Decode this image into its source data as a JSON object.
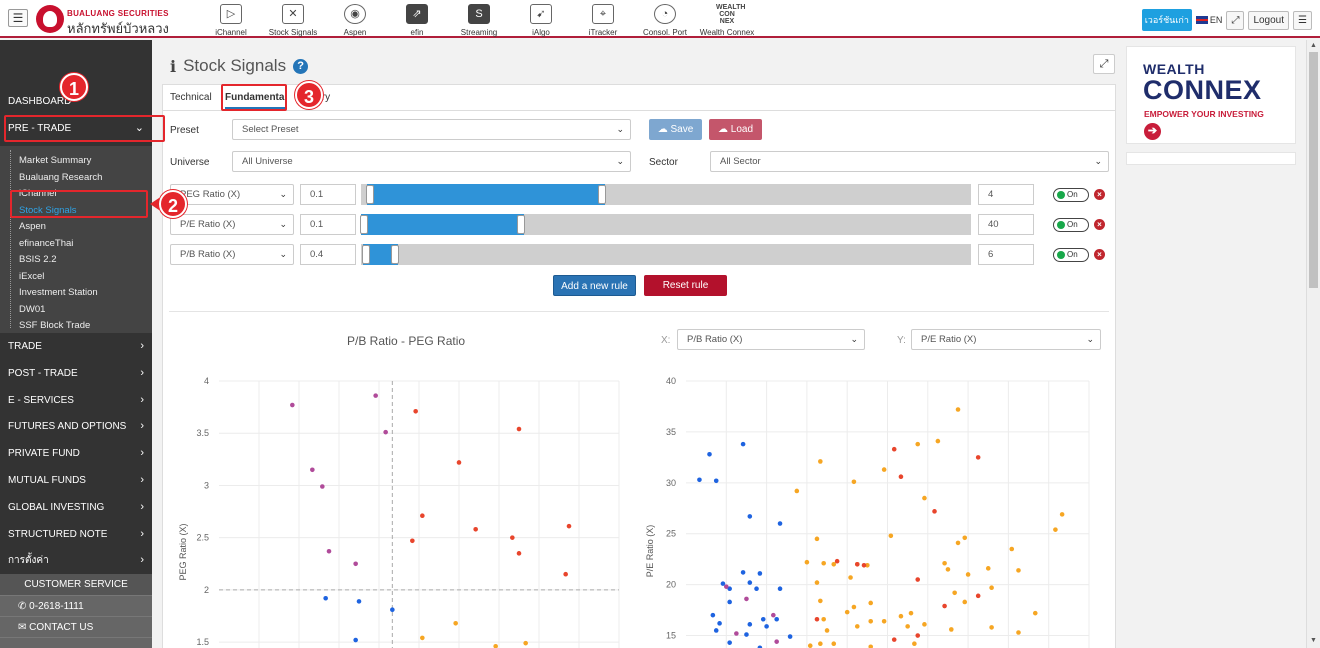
{
  "header": {
    "brand_en": "BUALUANG SECURITIES",
    "brand_th": "หลักทรัพย์บัวหลวง",
    "apps": [
      {
        "label": "iChannel",
        "icon": "play-icon",
        "glyph": "▷"
      },
      {
        "label": "Stock Signals",
        "icon": "chart-icon",
        "glyph": "✕"
      },
      {
        "label": "Aspen",
        "icon": "globe-icon",
        "glyph": "◉"
      },
      {
        "label": "efin",
        "icon": "efin-icon",
        "glyph": "⇗"
      },
      {
        "label": "Streaming",
        "icon": "streaming-icon",
        "glyph": "S"
      },
      {
        "label": "iAlgo",
        "icon": "rocket-icon",
        "glyph": "➹"
      },
      {
        "label": "iTracker",
        "icon": "telescope-icon",
        "glyph": "⌖"
      },
      {
        "label": "Consol. Port",
        "icon": "pie-icon",
        "glyph": "◔"
      },
      {
        "label": "Wealth Connex",
        "icon": "wealth-connex-icon",
        "glyph": "WEALTH CON NEX"
      }
    ],
    "old_version": "เวอร์ชันเก่า",
    "lang": "EN",
    "logout": "Logout"
  },
  "sidebar": {
    "top_items": [
      "DASHBOARD",
      "PRE - TRADE"
    ],
    "sub_items": [
      "Market Summary",
      "Bualuang Research",
      "iChannel",
      "Stock Signals",
      "Aspen",
      "efinanceThai",
      "BSIS 2.2",
      "iExcel",
      "Investment Station",
      "DW01",
      "SSF Block Trade"
    ],
    "active_sub": "Stock Signals",
    "bottom_items": [
      "TRADE",
      "POST - TRADE",
      "E - SERVICES",
      "FUTURES AND OPTIONS",
      "PRIVATE FUND",
      "MUTUAL FUNDS",
      "GLOBAL INVESTING",
      "STRUCTURED NOTE",
      "การตั้งค่า"
    ],
    "customer_service": "CUSTOMER SERVICE",
    "phone": "0-2618-1111",
    "contact": "CONTACT US"
  },
  "page": {
    "title": "Stock Signals",
    "tabs": [
      "Technical",
      "Fundamental",
      "History"
    ],
    "active_tab": "Fundamental",
    "preset_label": "Preset",
    "preset_value": "Select Preset",
    "save": "Save",
    "load": "Load",
    "universe_label": "Universe",
    "universe_value": "All Universe",
    "sector_label": "Sector",
    "sector_value": "All Sector",
    "rules": [
      {
        "metric": "PEG Ratio (X)",
        "min": "0.1",
        "max": "4",
        "range": [
          0.1,
          4
        ],
        "slider_max": 10,
        "toggle": "On"
      },
      {
        "metric": "P/E Ratio (X)",
        "min": "0.1",
        "max": "40",
        "range": [
          0.1,
          40
        ],
        "slider_max": 150,
        "toggle": "On"
      },
      {
        "metric": "P/B Ratio (X)",
        "min": "0.4",
        "max": "6",
        "range": [
          0.4,
          6
        ],
        "slider_max": 100,
        "toggle": "On"
      }
    ],
    "add_rule": "Add a new rule",
    "reset_rule": "Reset rule",
    "x_label": "X:",
    "y_label": "Y:",
    "x_select": "P/B Ratio (X)",
    "y_select": "P/E Ratio (X)"
  },
  "callouts": [
    "1",
    "2",
    "3"
  ],
  "ad": {
    "line1": "WEALTH",
    "line2": "CONNEX",
    "line3": "EMPOWER YOUR INVESTING"
  },
  "colors": {
    "accent": "#2475b8",
    "brand": "#c8102e",
    "blue": "#1e63e0",
    "orange": "#f6a623",
    "red": "#e8452c",
    "purple": "#b04b9a"
  },
  "chart_data": [
    {
      "type": "scatter",
      "title": "P/B Ratio - PEG Ratio",
      "xlabel": "",
      "ylabel": "PEG Ratio (X)",
      "ylim": [
        1.3,
        4
      ],
      "yticks": [
        1.5,
        2,
        2.5,
        3,
        3.5,
        4
      ],
      "xlim": [
        0,
        6
      ],
      "crosshair": {
        "x": 2.6,
        "y": 2
      },
      "series": [
        {
          "color": "purple",
          "points": [
            [
              1.1,
              3.77
            ],
            [
              1.4,
              3.15
            ],
            [
              1.55,
              2.99
            ],
            [
              1.65,
              2.37
            ],
            [
              2.05,
              2.25
            ],
            [
              2.35,
              3.86
            ],
            [
              2.5,
              3.51
            ]
          ]
        },
        {
          "color": "red",
          "points": [
            [
              2.95,
              3.71
            ],
            [
              3.05,
              2.71
            ],
            [
              2.9,
              2.47
            ],
            [
              3.6,
              3.22
            ],
            [
              3.85,
              2.58
            ],
            [
              4.5,
              3.54
            ],
            [
              4.4,
              2.5
            ],
            [
              4.5,
              2.35
            ],
            [
              5.25,
              2.61
            ],
            [
              5.2,
              2.15
            ]
          ]
        },
        {
          "color": "blue",
          "points": [
            [
              1.6,
              1.92
            ],
            [
              2.1,
              1.89
            ],
            [
              2.05,
              1.52
            ],
            [
              1.9,
              1.22
            ],
            [
              2.0,
              1.24
            ],
            [
              2.6,
              1.81
            ],
            [
              2.65,
              1.39
            ]
          ]
        },
        {
          "color": "orange",
          "points": [
            [
              3.55,
              1.68
            ],
            [
              3.05,
              1.54
            ],
            [
              3.05,
              1.33
            ],
            [
              3.3,
              1.31
            ],
            [
              4.15,
              1.46
            ],
            [
              4.6,
              1.49
            ],
            [
              4.2,
              1.23
            ],
            [
              3.75,
              1.21
            ],
            [
              5.95,
              1.35
            ]
          ]
        }
      ]
    },
    {
      "type": "scatter",
      "title": "",
      "xlabel": "P/B Ratio (X)",
      "ylabel": "P/E Ratio (X)",
      "ylim": [
        12.5,
        40
      ],
      "yticks": [
        15,
        20,
        25,
        30,
        35,
        40
      ],
      "xlim": [
        0,
        6
      ],
      "series": [
        {
          "color": "blue",
          "points": [
            [
              0.05,
              13.2
            ],
            [
              0.2,
              30.3
            ],
            [
              0.35,
              32.8
            ],
            [
              0.45,
              30.2
            ],
            [
              0.85,
              33.8
            ],
            [
              0.95,
              26.7
            ],
            [
              1.4,
              26
            ],
            [
              0.85,
              21.2
            ],
            [
              1.1,
              21.1
            ],
            [
              1.05,
              19.6
            ],
            [
              0.65,
              18.3
            ],
            [
              0.4,
              17
            ],
            [
              0.45,
              15.5
            ],
            [
              0.5,
              16.2
            ],
            [
              0.65,
              19.6
            ],
            [
              0.55,
              20.1
            ],
            [
              0.95,
              20.2
            ],
            [
              1.15,
              16.6
            ],
            [
              1.2,
              15.9
            ],
            [
              1.35,
              16.6
            ],
            [
              1.4,
              19.6
            ],
            [
              0.95,
              16.1
            ],
            [
              0.9,
              15.1
            ],
            [
              0.85,
              13.5
            ],
            [
              0.65,
              14.3
            ],
            [
              0.45,
              13.3
            ],
            [
              0.5,
              12.9
            ],
            [
              0.8,
              13.1
            ],
            [
              1.1,
              13.8
            ],
            [
              1.3,
              12.9
            ],
            [
              1.2,
              12.7
            ],
            [
              1.55,
              14.9
            ]
          ]
        },
        {
          "color": "orange",
          "points": [
            [
              1.65,
              29.2
            ],
            [
              1.95,
              24.5
            ],
            [
              2.0,
              32.1
            ],
            [
              2.5,
              30.1
            ],
            [
              2.95,
              31.3
            ],
            [
              3.05,
              24.8
            ],
            [
              3.45,
              33.8
            ],
            [
              3.75,
              34.1
            ],
            [
              4.05,
              37.2
            ],
            [
              3.55,
              28.5
            ],
            [
              3.85,
              22.1
            ],
            [
              3.9,
              21.5
            ],
            [
              4.15,
              24.6
            ],
            [
              4.05,
              24.1
            ],
            [
              4.2,
              21
            ],
            [
              4.0,
              19.2
            ],
            [
              4.5,
              21.6
            ],
            [
              4.55,
              19.7
            ],
            [
              4.15,
              18.3
            ],
            [
              3.95,
              15.6
            ],
            [
              4.55,
              15.8
            ],
            [
              4.85,
              23.5
            ],
            [
              4.95,
              21.4
            ],
            [
              5.2,
              17.2
            ],
            [
              5.5,
              25.4
            ],
            [
              5.6,
              26.9
            ],
            [
              3.2,
              16.9
            ],
            [
              3.3,
              15.9
            ],
            [
              3.55,
              16.1
            ],
            [
              2.5,
              17.8
            ],
            [
              2.75,
              16.4
            ],
            [
              2.75,
              18.2
            ],
            [
              2.95,
              16.4
            ],
            [
              2.0,
              18.4
            ],
            [
              2.45,
              20.7
            ],
            [
              2.55,
              22
            ],
            [
              2.7,
              21.9
            ],
            [
              2.2,
              22
            ],
            [
              2.05,
              22.1
            ],
            [
              1.95,
              20.2
            ],
            [
              1.8,
              22.2
            ],
            [
              2.05,
              16.6
            ],
            [
              2.1,
              15.5
            ],
            [
              2.0,
              14.2
            ],
            [
              2.4,
              17.3
            ],
            [
              2.55,
              15.9
            ],
            [
              3.35,
              17.2
            ],
            [
              1.9,
              12.8
            ],
            [
              1.75,
              12.8
            ],
            [
              1.6,
              13.2
            ],
            [
              2.35,
              12.6
            ],
            [
              2.75,
              12.5
            ],
            [
              3.05,
              13.5
            ],
            [
              3.6,
              13.2
            ],
            [
              3.95,
              12.9
            ],
            [
              4.3,
              13.2
            ],
            [
              4.55,
              13.5
            ],
            [
              4.85,
              13.3
            ],
            [
              4.95,
              15.3
            ],
            [
              3.4,
              14.2
            ],
            [
              2.75,
              13.9
            ],
            [
              1.85,
              14
            ],
            [
              2.2,
              14.2
            ]
          ]
        },
        {
          "color": "red",
          "points": [
            [
              3.1,
              33.3
            ],
            [
              3.2,
              30.6
            ],
            [
              4.35,
              32.5
            ],
            [
              3.7,
              27.2
            ],
            [
              3.45,
              20.5
            ],
            [
              4.35,
              18.9
            ],
            [
              3.85,
              17.9
            ],
            [
              2.55,
              22
            ],
            [
              2.25,
              22.3
            ],
            [
              2.65,
              21.9
            ],
            [
              1.95,
              16.6
            ],
            [
              3.1,
              14.6
            ],
            [
              3.45,
              15
            ],
            [
              1.35,
              13.3
            ]
          ]
        },
        {
          "color": "purple",
          "points": [
            [
              0.2,
              13.3
            ],
            [
              0.6,
              19.8
            ],
            [
              0.9,
              18.6
            ],
            [
              1.3,
              17
            ],
            [
              0.75,
              15.2
            ],
            [
              0.4,
              13.4
            ],
            [
              1.35,
              14.4
            ]
          ]
        }
      ]
    }
  ]
}
